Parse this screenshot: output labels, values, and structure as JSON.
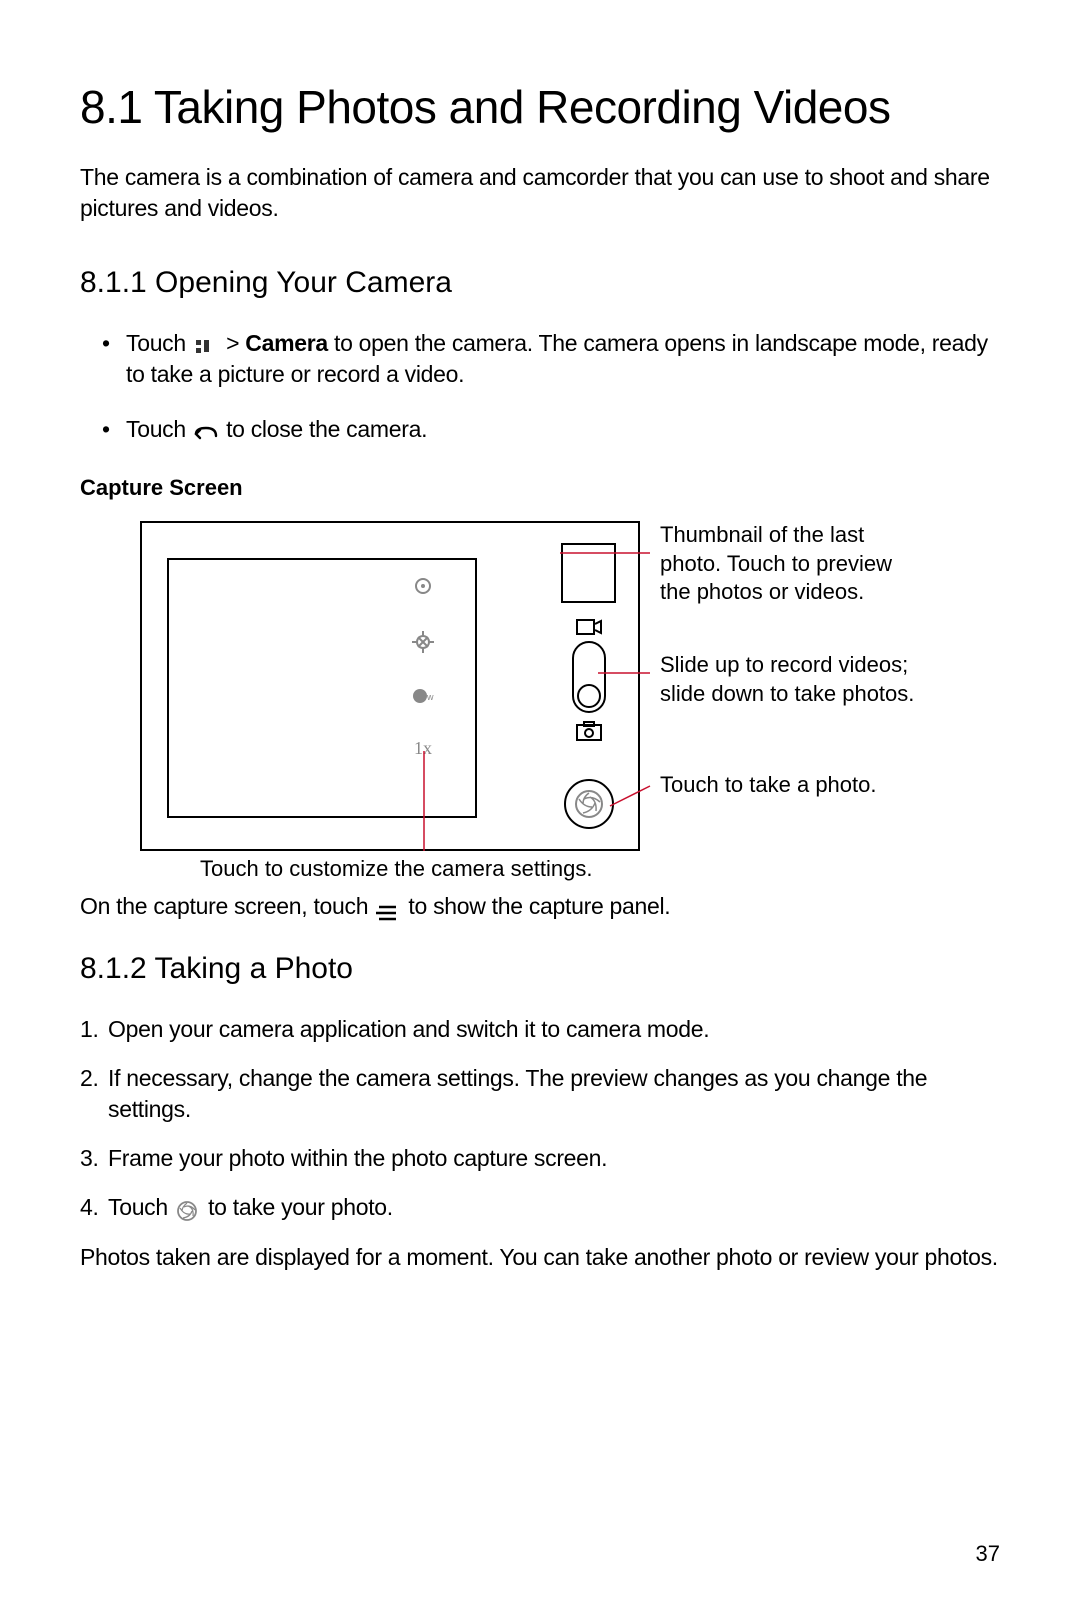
{
  "heading": "8.1  Taking Photos and Recording Videos",
  "intro": "The camera is a combination of camera and camcorder that you can use to shoot and share pictures and videos.",
  "sub1": {
    "title": "8.1.1  Opening Your Camera",
    "bullet1_pre": "Touch ",
    "bullet1_mid": " > ",
    "bullet1_bold": "Camera",
    "bullet1_post": " to open the camera. The camera opens in landscape mode, ready to take a picture or record a video.",
    "bullet2_pre": "Touch ",
    "bullet2_post": " to close the camera.",
    "capture_label": "Capture Screen"
  },
  "figure": {
    "callout1": "Thumbnail of the last photo. Touch to preview the photos or videos.",
    "callout2": "Slide up to record videos; slide down to take photos.",
    "callout3": "Touch to take a photo.",
    "caption": "Touch to customize the camera settings.",
    "zoom": "1x"
  },
  "para1_pre": "On the capture screen, touch ",
  "para1_post": " to show the capture panel.",
  "sub2": {
    "title": "8.1.2  Taking a Photo",
    "step1": "Open your camera application and switch it to camera mode.",
    "step2": "If necessary, change the camera settings. The preview changes as you change the settings.",
    "step3": "Frame your photo within the photo capture screen.",
    "step4_pre": "Touch ",
    "step4_post": " to take your photo.",
    "closing": "Photos taken are displayed for a moment. You can take another photo or review your photos."
  },
  "page_number": "37"
}
